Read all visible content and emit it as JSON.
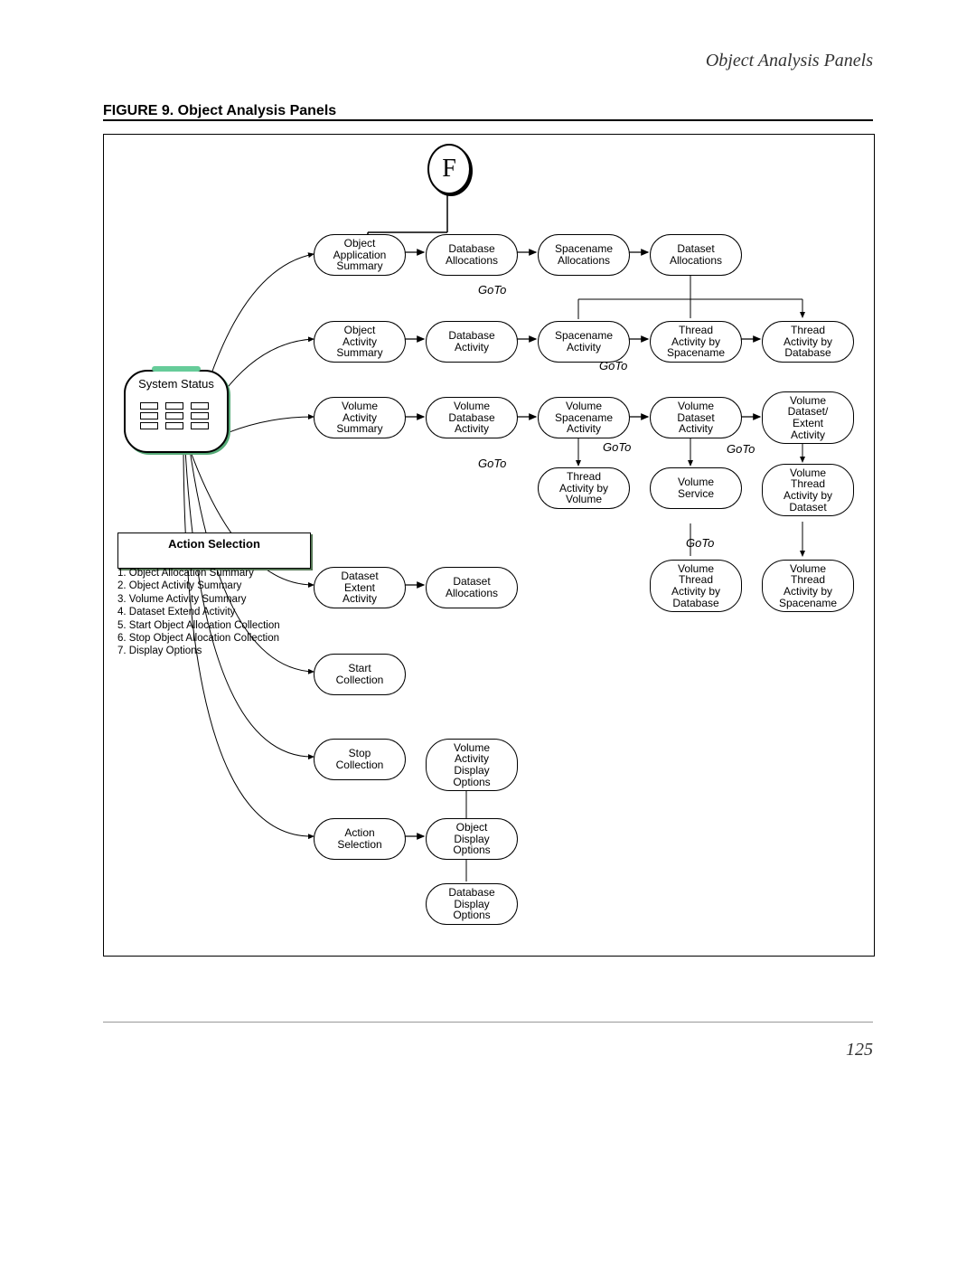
{
  "header": {
    "title": "Object Analysis Panels"
  },
  "figure_caption": "FIGURE 9.  Object Analysis Panels",
  "page_number": "125",
  "circle": "F",
  "goto_label": "GoTo",
  "system_status": "System Status",
  "action_selection_title": "Action Selection",
  "action_selection_items": [
    "1. Object Allocation Summary",
    "2. Object Activity Summary",
    "3. Volume Activity Summary",
    "4. Dataset Extend Activity",
    "5. Start Object Allocation Collection",
    "6. Stop Object Allocation Collection",
    "7. Display Options"
  ],
  "nodes": {
    "r1c1": "Object\nApplication\nSummary",
    "r1c2": "Database\nAllocations",
    "r1c3": "Spacename\nAllocations",
    "r1c4": "Dataset\nAllocations",
    "r2c1": "Object\nActivity\nSummary",
    "r2c2": "Database\nActivity",
    "r2c3": "Spacename\nActivity",
    "r2c4": "Thread\nActivity by\nSpacename",
    "r2c5": "Thread\nActivity by\nDatabase",
    "r3c1": "Volume\nActivity\nSummary",
    "r3c2": "Volume\nDatabase\nActivity",
    "r3c3": "Volume\nSpacename\nActivity",
    "r3c4": "Volume\nDataset\nActivity",
    "r3c5": "Volume\nDataset/\nExtent\nActivity",
    "r4c3": "Thread\nActivity by\nVolume",
    "r4c4": "Volume\nService",
    "r4c5": "Volume\nThread\nActivity by\nDataset",
    "r5c1": "Dataset\nExtent\nActivity",
    "r5c2": "Dataset\nAllocations",
    "r5c4": "Volume\nThread\nActivity by\nDatabase",
    "r5c5": "Volume\nThread\nActivity by\nSpacename",
    "r6c1": "Start\nCollection",
    "r7c1": "Stop\nCollection",
    "r7c2": "Volume\nActivity\nDisplay\nOptions",
    "r8c1": "Action\nSelection",
    "r8c2": "Object\nDisplay\nOptions",
    "r9c2": "Database\nDisplay\nOptions"
  }
}
